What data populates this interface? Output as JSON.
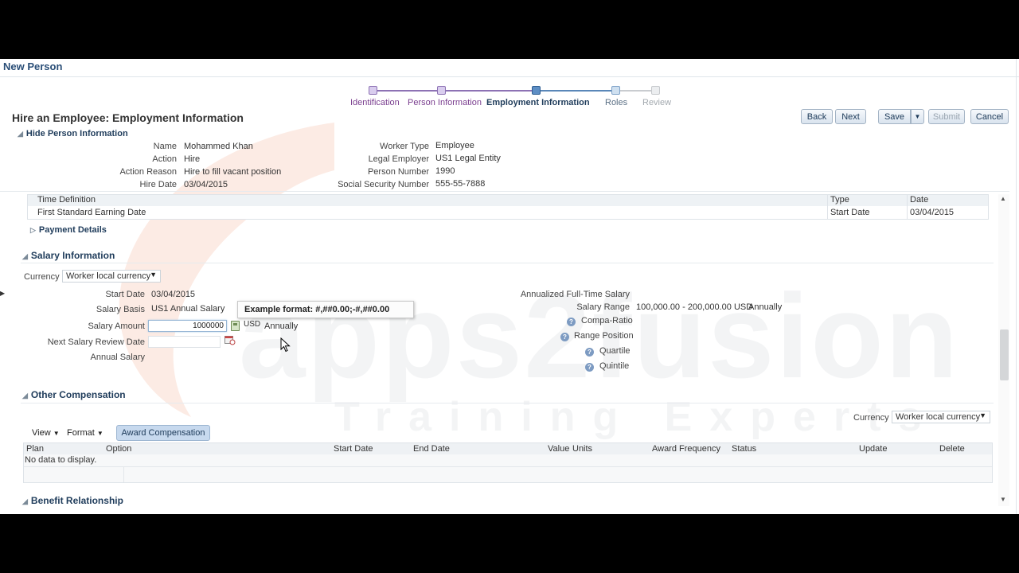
{
  "page_title": "New Person",
  "train": {
    "steps": [
      {
        "label": "Identification"
      },
      {
        "label": "Person Information"
      },
      {
        "label": "Employment Information"
      },
      {
        "label": "Roles"
      },
      {
        "label": "Review"
      }
    ]
  },
  "header": {
    "title": "Hire an Employee: Employment Information",
    "hide_person_info": "Hide Person Information"
  },
  "buttons": {
    "back": "Back",
    "next": "Next",
    "save": "Save",
    "submit": "Submit",
    "cancel": "Cancel"
  },
  "person_info": {
    "left": [
      {
        "label": "Name",
        "value": "Mohammed Khan"
      },
      {
        "label": "Action",
        "value": "Hire"
      },
      {
        "label": "Action Reason",
        "value": "Hire to fill vacant position"
      },
      {
        "label": "Hire Date",
        "value": "03/04/2015"
      }
    ],
    "right": [
      {
        "label": "Worker Type",
        "value": "Employee"
      },
      {
        "label": "Legal Employer",
        "value": "US1 Legal Entity"
      },
      {
        "label": "Person Number",
        "value": "1990"
      },
      {
        "label": "Social Security Number",
        "value": "555-55-7888"
      }
    ]
  },
  "time_table": {
    "columns": [
      "Time Definition",
      "Type",
      "Date"
    ],
    "rows": [
      {
        "definition": "First Standard Earning Date",
        "type": "Start Date",
        "date": "03/04/2015"
      }
    ]
  },
  "payment_details": "Payment Details",
  "salary": {
    "section_title": "Salary Information",
    "currency_label": "Currency",
    "currency_value": "Worker local currency",
    "start_date_label": "Start Date",
    "start_date": "03/04/2015",
    "salary_basis_label": "Salary Basis",
    "salary_basis": "US1 Annual Salary",
    "salary_amount_label": "Salary Amount",
    "salary_amount": "1000000",
    "amount_currency": "USD",
    "amount_frequency": "Annually",
    "next_review_label": "Next Salary Review Date",
    "annual_salary_label": "Annual Salary",
    "tooltip": "Example format: #,##0.00;-#,##0.00",
    "annualized_label": "Annualized Full-Time Salary",
    "range_label": "Salary Range",
    "range_value": "100,000.00 - 200,000.00 USD",
    "range_frequency": "Annually",
    "compa_ratio": "Compa-Ratio",
    "range_position": "Range Position",
    "quartile": "Quartile",
    "quintile": "Quintile"
  },
  "other_comp": {
    "section_title": "Other Compensation",
    "currency_label": "Currency",
    "currency_value": "Worker local currency",
    "view_menu": "View",
    "format_menu": "Format",
    "award_button": "Award Compensation",
    "columns": [
      "Plan",
      "Option",
      "Start Date",
      "End Date",
      "Value",
      "Units",
      "Award Frequency",
      "Status",
      "Update",
      "Delete"
    ],
    "empty": "No data to display."
  },
  "benefit": {
    "section_title": "Benefit Relationship"
  },
  "watermark": {
    "brand": "apps2fusion",
    "tagline": "Training Experts"
  },
  "colors": {
    "header_blue": "#2a4e77",
    "train_purple": "#7a3e8f",
    "train_active": "#1f3c5b",
    "watermark_orange": "#e8612c"
  }
}
